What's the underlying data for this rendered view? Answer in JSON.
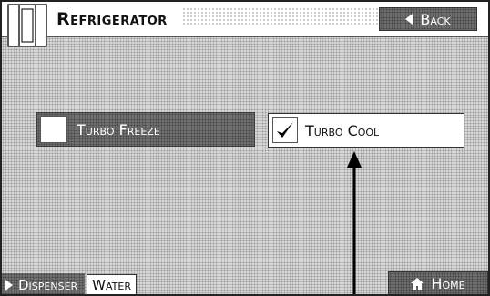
{
  "header": {
    "title": "Refrigerator",
    "back_label": "Back",
    "icon": "refrigerator-icon"
  },
  "options": [
    {
      "label": "Turbo Freeze",
      "checked": false
    },
    {
      "label": "Turbo Cool",
      "checked": true
    }
  ],
  "footer": {
    "dispenser_label": "Dispenser",
    "dispenser_value": "Water",
    "home_label": "Home"
  },
  "colors": {
    "background": "#c9c9c9",
    "button": "#6d6d6d",
    "text_light": "#ffffff",
    "text_dark": "#111111"
  }
}
